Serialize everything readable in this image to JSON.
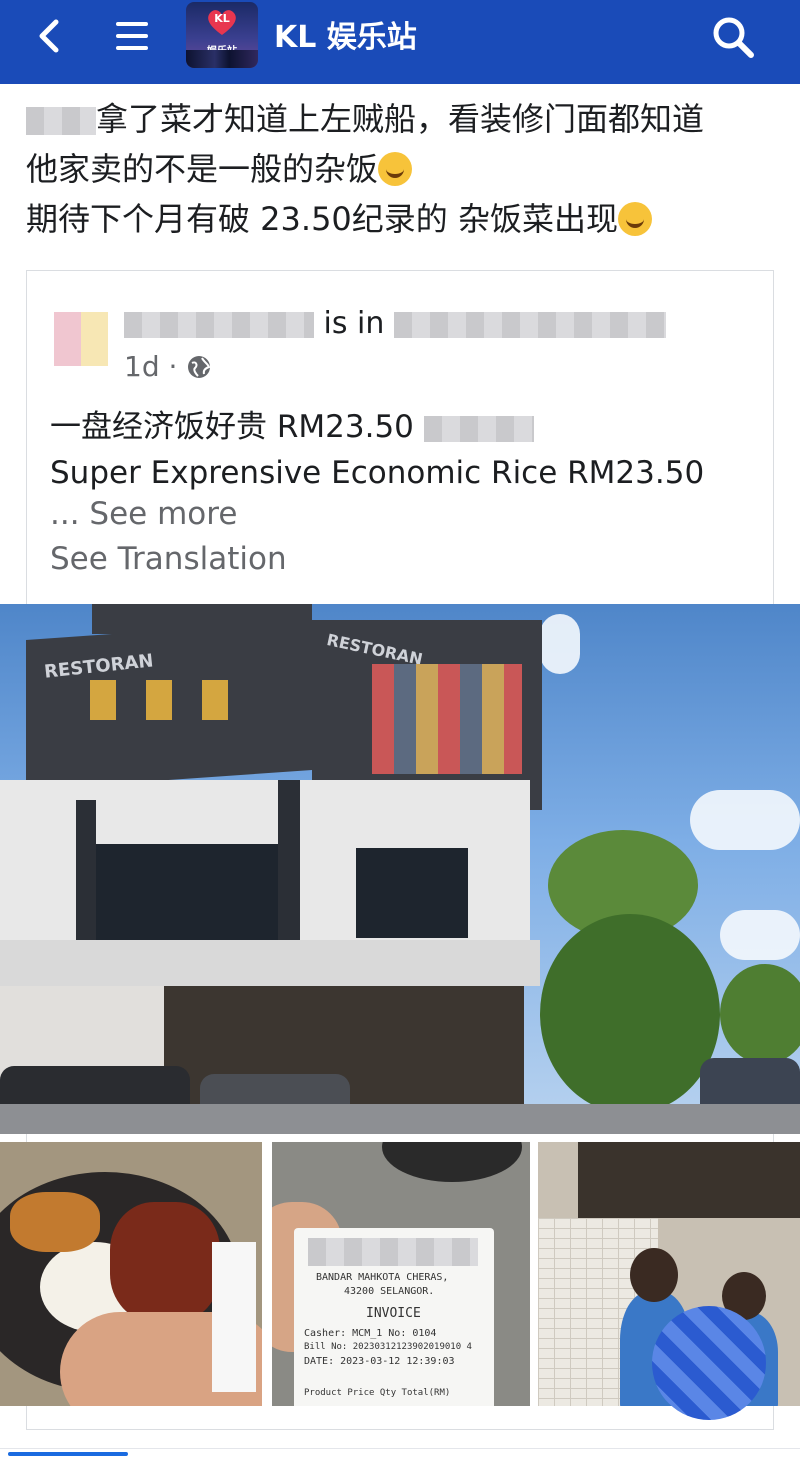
{
  "header": {
    "title": "KL 娱乐站",
    "logo_text_top": "KL",
    "logo_text_bottom": "娱乐站",
    "background_color": "#1a4bb8",
    "icons": [
      "back-icon",
      "menu-icon",
      "search-icon"
    ]
  },
  "post": {
    "line1": "拿了菜才知道上左贼船，看装修门面都知道",
    "line2": "他家卖的不是一般的杂饭",
    "line3": "期待下个月有破 23.50纪录的 杂饭菜出现"
  },
  "shared_post": {
    "location_prefix": "is in",
    "time": "1d ·",
    "body_line1": "一盘经济饭好贵 RM23.50",
    "body_line2": "Super Exprensive Economic Rice RM23.50",
    "see_more": "... See more",
    "see_translation": "See Translation"
  },
  "photos": {
    "main_sign_text": "RESTORAN",
    "main_sign_text_2": "RESTORAN",
    "receipt_lines": [
      "BANDAR MAHKOTA CHERAS,",
      "43200 SELANGOR.",
      "INVOICE",
      "Casher: MCM_1 No: 0104",
      "Bill No: 20230312123902019010 4",
      "DATE: 2023-03-12 12:39:03",
      "Product  Price  Qty  Total(RM)"
    ]
  }
}
